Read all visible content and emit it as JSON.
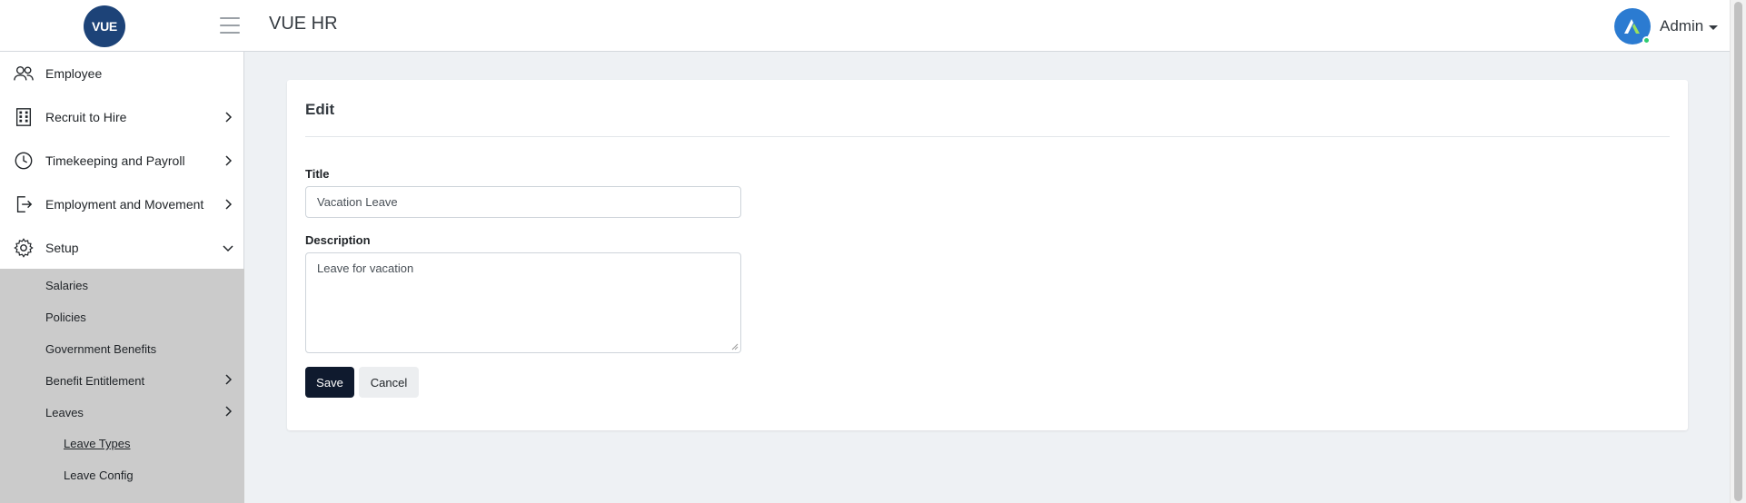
{
  "header": {
    "logo_text": "VUE",
    "app_title": "VUE HR",
    "user_name": "Admin"
  },
  "sidebar": {
    "items": [
      {
        "label": "Employee",
        "icon": "users-icon"
      },
      {
        "label": "Recruit to Hire",
        "icon": "building-icon"
      },
      {
        "label": "Timekeeping and Payroll",
        "icon": "clock-icon"
      },
      {
        "label": "Employment and Movement",
        "icon": "exit-icon"
      },
      {
        "label": "Setup",
        "icon": "gear-icon"
      }
    ],
    "setup_children": {
      "salaries": "Salaries",
      "policies": "Policies",
      "government_benefits": "Government Benefits",
      "benefit_entitlement": "Benefit Entitlement",
      "leaves": "Leaves",
      "leave_types": "Leave Types",
      "leave_config": "Leave Config"
    }
  },
  "form": {
    "title": "Edit",
    "title_label": "Title",
    "title_value": "Vacation Leave",
    "description_label": "Description",
    "description_value": "Leave for vacation",
    "save_label": "Save",
    "cancel_label": "Cancel"
  },
  "colors": {
    "brand": "#1d4378",
    "primary_button": "#0f1a2e",
    "submenu_bg": "#cbcbcb",
    "page_bg": "#eef1f4"
  }
}
